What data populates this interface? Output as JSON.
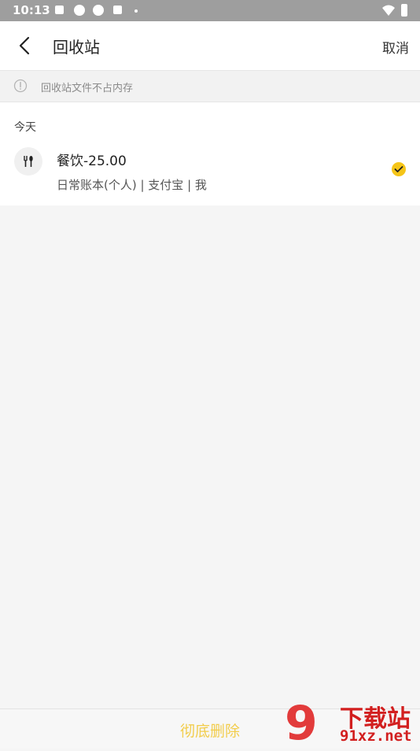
{
  "status_bar": {
    "time": "10:13"
  },
  "nav": {
    "title": "回收站",
    "cancel_label": "取消"
  },
  "notice": {
    "text": "回收站文件不占内存"
  },
  "section": {
    "date_label": "今天"
  },
  "record": {
    "title": "餐饮-25.00",
    "subtitle": "日常账本(个人) | 支付宝 | 我",
    "selected": true
  },
  "bottom": {
    "delete_label": "彻底删除"
  },
  "watermark": {
    "title": "下载站",
    "url": "91xz.net"
  },
  "colors": {
    "accent": "#f5c518",
    "delete": "#f2cd4c",
    "watermark": "#d21f1f"
  }
}
